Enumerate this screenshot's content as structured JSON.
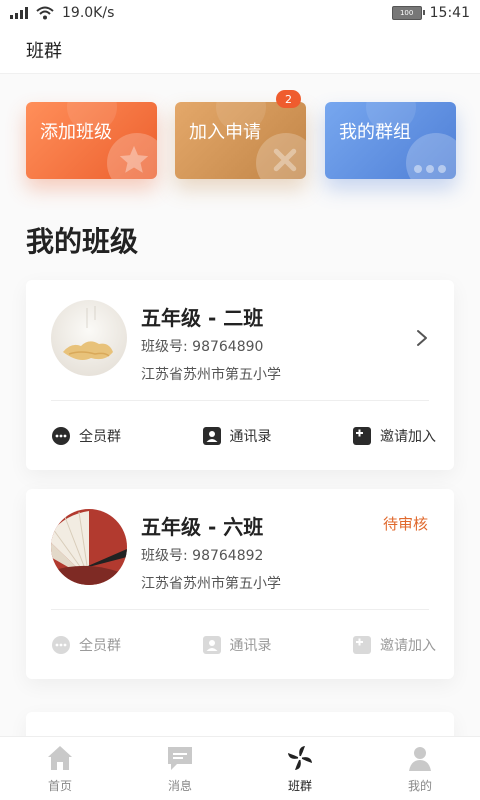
{
  "status_bar": {
    "speed": "19.0K/s",
    "battery": "100",
    "time": "15:41"
  },
  "header": {
    "title": "班群"
  },
  "quick_actions": [
    {
      "label": "添加班级",
      "icon": "star-icon"
    },
    {
      "label": "加入申请",
      "icon": "close-icon",
      "badge": "2"
    },
    {
      "label": "我的群组",
      "icon": "chat-dots-icon"
    }
  ],
  "section_title": "我的班级",
  "classes": [
    {
      "name": "五年级 - 二班",
      "number_label": "班级号:",
      "number": "98764890",
      "school": "江苏省苏州市第五小学",
      "status": "",
      "actions": [
        "全员群",
        "通讯录",
        "邀请加入"
      ]
    },
    {
      "name": "五年级 - 六班",
      "number_label": "班级号:",
      "number": "98764892",
      "school": "江苏省苏州市第五小学",
      "status": "待审核",
      "actions": [
        "全员群",
        "通讯录",
        "邀请加入"
      ]
    }
  ],
  "bottom_nav": [
    {
      "label": "首页",
      "icon": "home-icon"
    },
    {
      "label": "消息",
      "icon": "message-icon"
    },
    {
      "label": "班群",
      "icon": "pinwheel-icon",
      "active": true
    },
    {
      "label": "我的",
      "icon": "user-icon"
    }
  ],
  "colors": {
    "accent": "#ec5f2d",
    "pending": "#e0692d"
  }
}
